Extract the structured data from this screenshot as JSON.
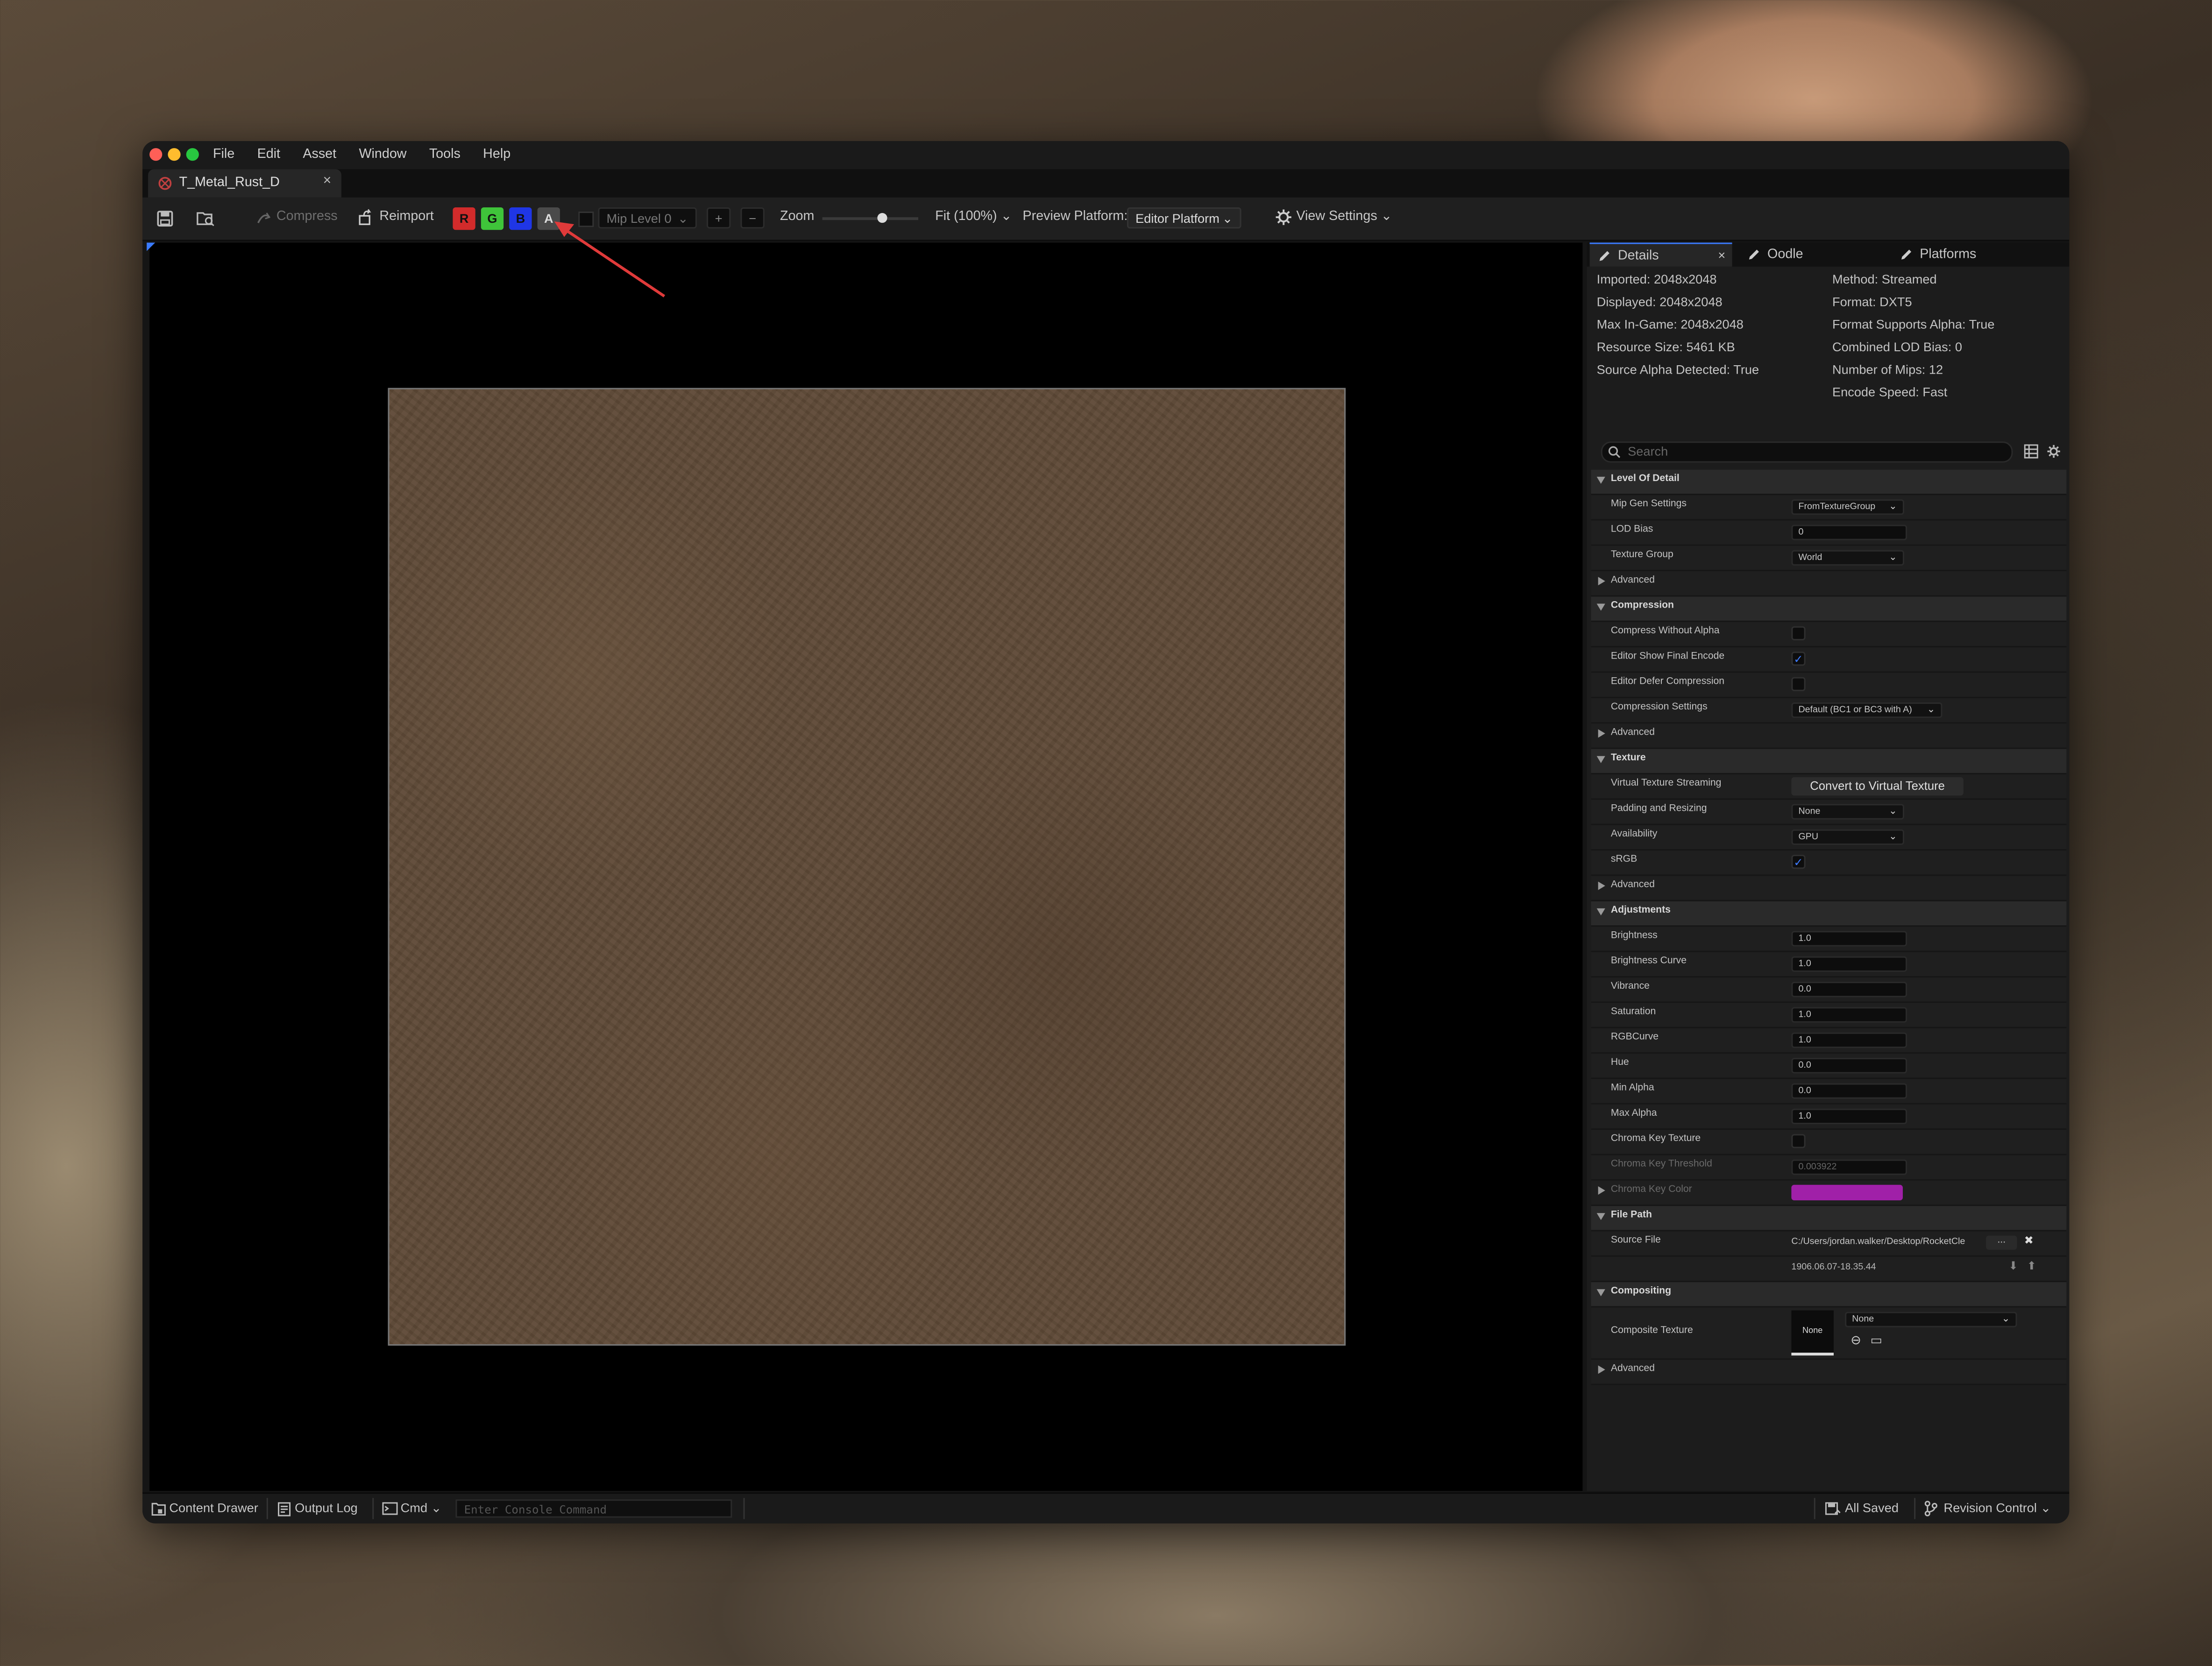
{
  "window": {
    "menu": [
      "File",
      "Edit",
      "Asset",
      "Window",
      "Tools",
      "Help"
    ],
    "tab_title": "T_Metal_Rust_D",
    "tab_close": "×"
  },
  "toolbar": {
    "compress": "Compress",
    "reimport": "Reimport",
    "channels": [
      {
        "label": "R",
        "color": "#d22b2b"
      },
      {
        "label": "G",
        "color": "#3fc43a"
      },
      {
        "label": "B",
        "color": "#1f36e6"
      },
      {
        "label": "A",
        "color": "#4a4a4a"
      }
    ],
    "mip_level": "Mip Level 0",
    "plus": "+",
    "minus": "−",
    "zoom_label": "Zoom",
    "zoom_fraction": 0.62,
    "fit": "Fit (100%)",
    "preview_platform_label": "Preview Platform:",
    "preview_platform_value": "Editor Platform",
    "view_settings": "View Settings"
  },
  "panel": {
    "tabs": [
      "Details",
      "Oodle",
      "Platforms"
    ],
    "tab_close": "×",
    "info_left": [
      "Imported: 2048x2048",
      "Displayed: 2048x2048",
      "Max In-Game: 2048x2048",
      "Resource Size: 5461 KB",
      "Source Alpha Detected: True"
    ],
    "info_right": [
      "Method: Streamed",
      "Format: DXT5",
      "Format Supports Alpha: True",
      "Combined LOD Bias: 0",
      "Number of Mips: 12",
      "Encode Speed: Fast"
    ],
    "search_placeholder": "Search",
    "rows": [
      {
        "type": "cat",
        "label": "Level Of Detail"
      },
      {
        "type": "dropdown",
        "label": "Mip Gen Settings",
        "value": "FromTextureGroup",
        "w": 80
      },
      {
        "type": "text",
        "label": "LOD Bias",
        "value": "0"
      },
      {
        "type": "dropdown",
        "label": "Texture Group",
        "value": "World",
        "w": 80
      },
      {
        "type": "adv",
        "label": "Advanced"
      },
      {
        "type": "cat",
        "label": "Compression"
      },
      {
        "type": "check",
        "label": "Compress Without Alpha",
        "checked": false
      },
      {
        "type": "check",
        "label": "Editor Show Final Encode",
        "checked": true
      },
      {
        "type": "check",
        "label": "Editor Defer Compression",
        "checked": false
      },
      {
        "type": "dropdown",
        "label": "Compression Settings",
        "value": "Default (BC1 or BC3 with A)",
        "w": 107
      },
      {
        "type": "adv",
        "label": "Advanced"
      },
      {
        "type": "cat",
        "label": "Texture"
      },
      {
        "type": "button",
        "label": "Virtual Texture Streaming",
        "value": "Convert to Virtual Texture"
      },
      {
        "type": "dropdown",
        "label": "Padding and Resizing",
        "value": "None",
        "w": 80
      },
      {
        "type": "dropdown",
        "label": "Availability",
        "value": "GPU",
        "w": 80
      },
      {
        "type": "check",
        "label": "sRGB",
        "checked": true
      },
      {
        "type": "adv",
        "label": "Advanced"
      },
      {
        "type": "cat",
        "label": "Adjustments"
      },
      {
        "type": "text",
        "label": "Brightness",
        "value": "1.0"
      },
      {
        "type": "text",
        "label": "Brightness Curve",
        "value": "1.0"
      },
      {
        "type": "text",
        "label": "Vibrance",
        "value": "0.0"
      },
      {
        "type": "text",
        "label": "Saturation",
        "value": "1.0"
      },
      {
        "type": "text",
        "label": "RGBCurve",
        "value": "1.0"
      },
      {
        "type": "text",
        "label": "Hue",
        "value": "0.0"
      },
      {
        "type": "text",
        "label": "Min Alpha",
        "value": "0.0"
      },
      {
        "type": "text",
        "label": "Max Alpha",
        "value": "1.0"
      },
      {
        "type": "check",
        "label": "Chroma Key Texture",
        "checked": false
      },
      {
        "type": "text",
        "label": "Chroma Key Threshold",
        "value": "0.003922",
        "dim": true
      },
      {
        "type": "color",
        "label": "Chroma Key Color",
        "value": "#a020a8",
        "dim": true
      },
      {
        "type": "cat",
        "label": "File Path"
      },
      {
        "type": "file",
        "label": "Source File",
        "value": "C:/Users/jordan.walker/Desktop/RocketCle",
        "browse": "...",
        "clear": "✖"
      },
      {
        "type": "timestamp",
        "label": "",
        "value": "1906.06.07-18.35.44"
      },
      {
        "type": "cat",
        "label": "Compositing"
      },
      {
        "type": "composite",
        "label": "Composite Texture",
        "thumb": "None",
        "value": "None"
      },
      {
        "type": "adv",
        "label": "Advanced"
      }
    ]
  },
  "status": {
    "content_drawer": "Content Drawer",
    "output_log": "Output Log",
    "cmd": "Cmd",
    "console_placeholder": "Enter Console Command",
    "all_saved": "All Saved",
    "revision_control": "Revision Control"
  }
}
